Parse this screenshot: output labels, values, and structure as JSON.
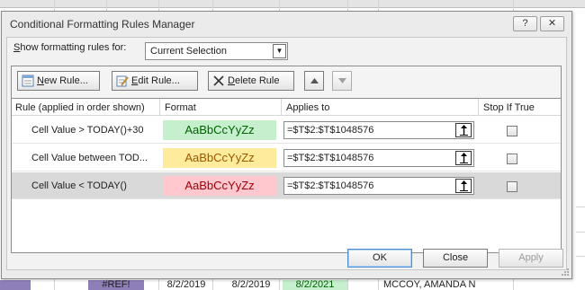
{
  "dialog": {
    "title": "Conditional Formatting Rules Manager",
    "help_label": "?",
    "close_label": "✕"
  },
  "show_rules": {
    "label": "Show formatting rules for:",
    "selected": "Current Selection"
  },
  "toolbar": {
    "new_rule": "New Rule...",
    "edit_rule": "Edit Rule...",
    "delete_rule": "Delete Rule"
  },
  "columns": {
    "rule": "Rule (applied in order shown)",
    "format": "Format",
    "applies_to": "Applies to",
    "stop_if_true": "Stop If True"
  },
  "rules": [
    {
      "name": "Cell Value > TODAY()+30",
      "preview": "AaBbCcYyZz",
      "fill": "#c6efce",
      "text_color": "#006100",
      "applies": "=$T$2:$T$1048576",
      "stop": false
    },
    {
      "name": "Cell Value between TOD...",
      "preview": "AaBbCcYyZz",
      "fill": "#ffeb9c",
      "text_color": "#9c5700",
      "applies": "=$T$2:$T$1048576",
      "stop": false
    },
    {
      "name": "Cell Value < TODAY()",
      "preview": "AaBbCcYyZz",
      "fill": "#ffc7ce",
      "text_color": "#9c0006",
      "applies": "=$T$2:$T$1048576",
      "stop": false
    }
  ],
  "footer": {
    "ok": "OK",
    "close": "Close",
    "apply": "Apply"
  },
  "sheet_row": {
    "cells": [
      "#REF!",
      "8/2/2019",
      "8/2/2019",
      "8/2/2021",
      "MCCOY, AMANDA N"
    ]
  }
}
